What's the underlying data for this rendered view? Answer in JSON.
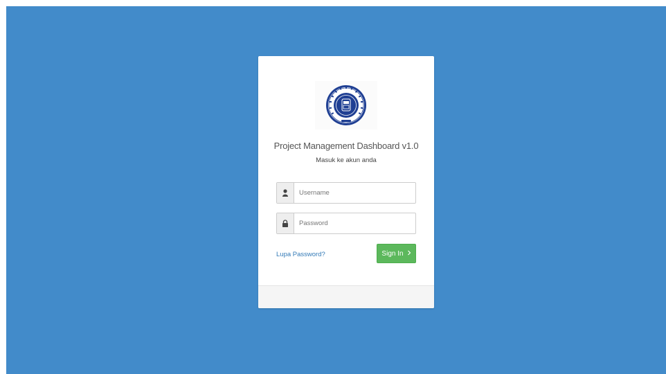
{
  "login": {
    "title": "Project Management Dashboard v1.0",
    "subtitle": "Masuk ke akun anda",
    "username_placeholder": "Username",
    "password_placeholder": "Password",
    "forgot_label": "Lupa Password?",
    "signin_label": "Sign In",
    "signin_icon": "chevron-right-icon"
  },
  "logo": {
    "icon": "institution-seal-logo"
  },
  "colors": {
    "background": "#428bca",
    "card": "#ffffff",
    "accent_green": "#5cb85c",
    "link": "#337ab7",
    "seal_blue": "#1f3f93"
  }
}
